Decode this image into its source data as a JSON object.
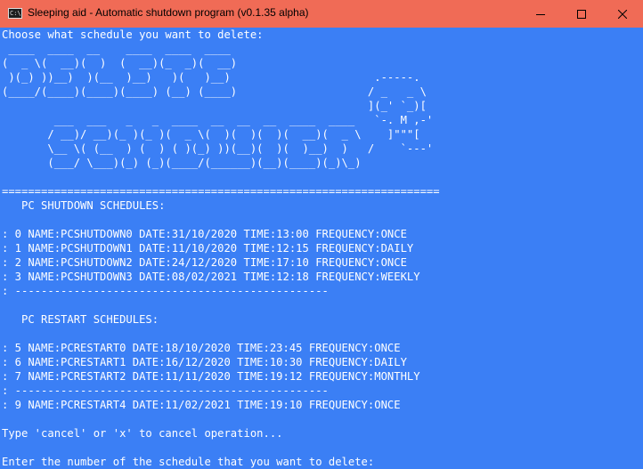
{
  "window": {
    "title": "Sleeping aid - Automatic shutdown program (v0.1.35 alpha)",
    "icon": "console-icon",
    "controls": [
      "minimize-icon",
      "maximize-icon",
      "close-icon"
    ],
    "colors": {
      "titlebar": "#f06b56",
      "console_bg": "#3b7ff5",
      "text": "#ffffff"
    }
  },
  "console": {
    "prompt_header": "Choose what schedule you want to delete:",
    "banner": [
      " ____  ____  __    ____  ____  ____",
      "(  _ \\(  __)(  )  (  __)(_  _)(  __)",
      " )(_) ))__)  )(__  )__)   )(   )__)                      .-----.",
      "(____/(____)(____)(____) (__) (____)                    / _   _ \\",
      "                                                        ](_' `_)[",
      "        ___  ___   _   _  ____  __  __  __  ____  ____   `-. M ,-'",
      "       / __)/ __)(_ )(_ )(  _ \\(  )(  )(  )(  __)(  _ \\    ]\"\"\"[",
      "       \\__ \\( (__  ) (  ) ( )(_) ))(__)(  )(  )__)  )   /    `---'",
      "       (___/ \\___)(_) (_)(____/(______)(__)(____)(_)\\_)"
    ],
    "separator": "===================================================================",
    "shutdown_header": "   PC SHUTDOWN SCHEDULES:",
    "shutdown_rows": [
      ": 0 NAME:PCSHUTDOWN0 DATE:31/10/2020 TIME:13:00 FREQUENCY:ONCE",
      ": 1 NAME:PCSHUTDOWN1 DATE:11/10/2020 TIME:12:15 FREQUENCY:DAILY",
      ": 2 NAME:PCSHUTDOWN2 DATE:24/12/2020 TIME:17:10 FREQUENCY:ONCE",
      ": 3 NAME:PCSHUTDOWN3 DATE:08/02/2021 TIME:12:18 FREQUENCY:WEEKLY"
    ],
    "shutdown_divider": ": ------------------------------------------------",
    "restart_header": "   PC RESTART SCHEDULES:",
    "restart_rows": [
      ": 5 NAME:PCRESTART0 DATE:18/10/2020 TIME:23:45 FREQUENCY:ONCE",
      ": 6 NAME:PCRESTART1 DATE:16/12/2020 TIME:10:30 FREQUENCY:DAILY",
      ": 7 NAME:PCRESTART2 DATE:11/11/2020 TIME:19:12 FREQUENCY:MONTHLY"
    ],
    "restart_divider": ": ------------------------------------------------",
    "restart_rows_after": [
      ": 9 NAME:PCRESTART4 DATE:11/02/2021 TIME:19:10 FREQUENCY:ONCE"
    ],
    "cancel_hint": "Type 'cancel' or 'x' to cancel operation...",
    "input_prompt": "Enter the number of the schedule that you want to delete:"
  }
}
